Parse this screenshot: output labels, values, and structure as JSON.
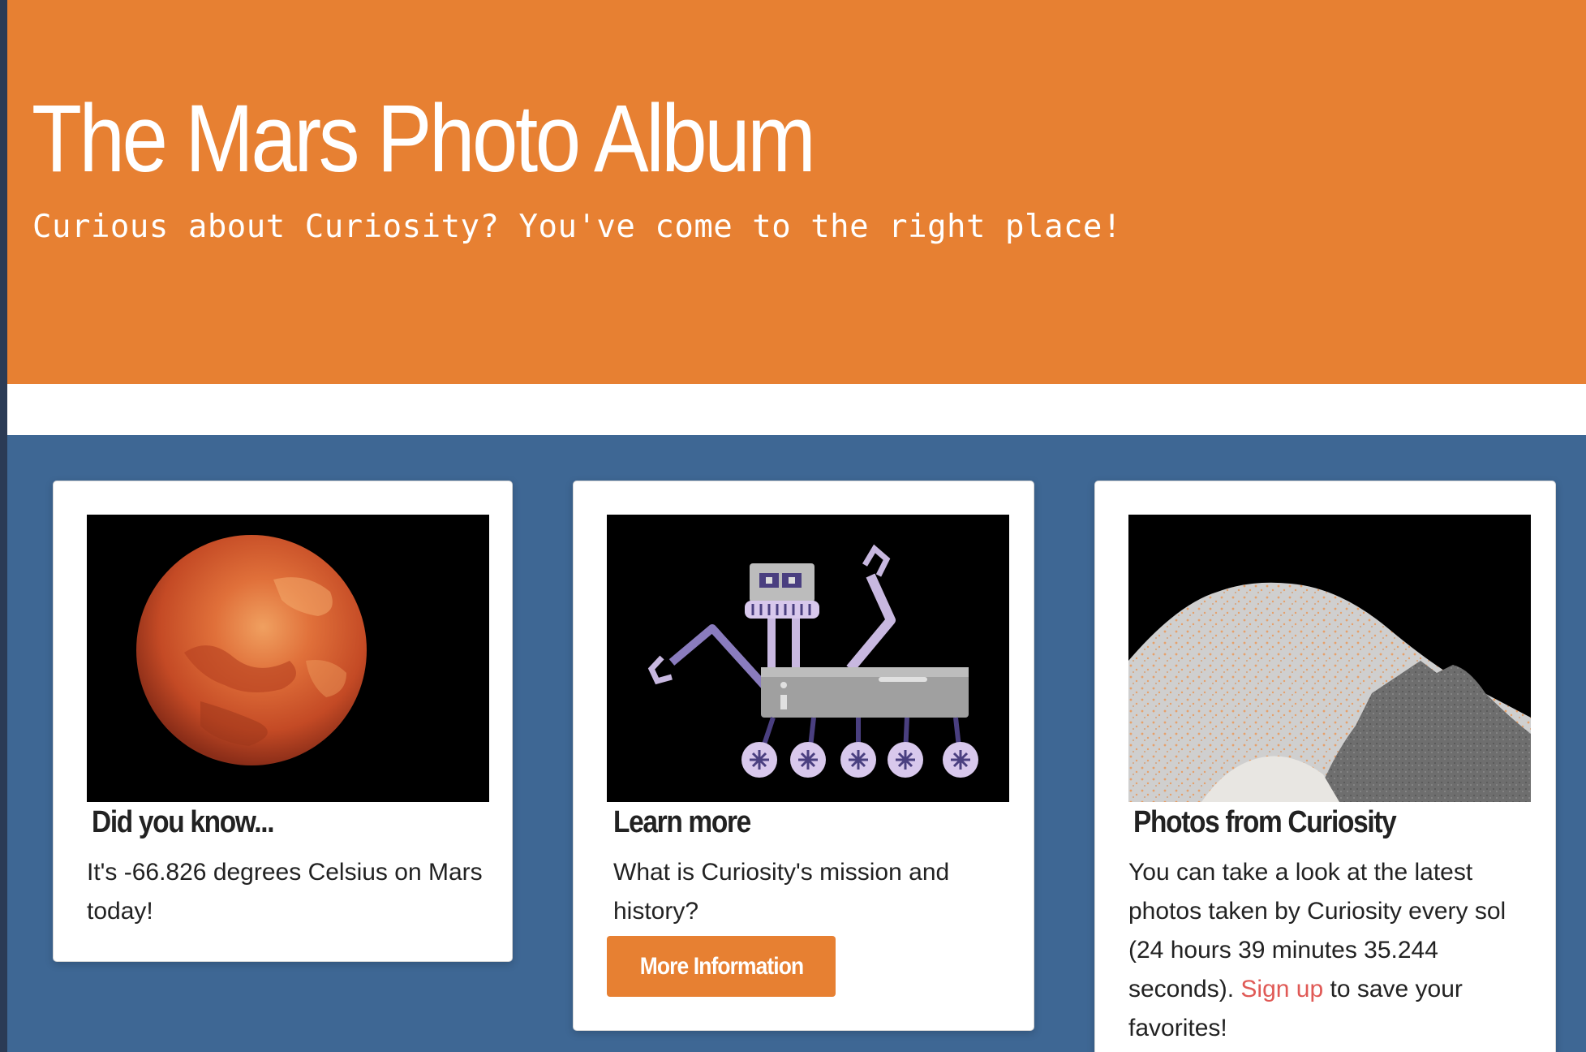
{
  "hero": {
    "title": "The Mars Photo Album",
    "subtitle": "Curious about Curiosity? You've come to the right place!",
    "background": "#e78032"
  },
  "cards": [
    {
      "image_icon": "mars-planet-illustration",
      "title": "Did you know...",
      "text": "It's -66.826 degrees Celsius on Mars today!"
    },
    {
      "image_icon": "curiosity-rover-illustration",
      "title": "Learn more",
      "text": "What is Curiosity's mission and history?",
      "button_label": "More Information"
    },
    {
      "image_icon": "mars-mountains-illustration",
      "title": "Photos from Curiosity",
      "text_before": "You can take a look at the latest photos taken by Curiosity every sol (24 hours 39 minutes 35.244 seconds). ",
      "link_label": "Sign up",
      "text_after": " to save your favorites!"
    }
  ],
  "colors": {
    "accent": "#e78032",
    "section_bg": "#3e6794",
    "link": "#e05a56"
  }
}
